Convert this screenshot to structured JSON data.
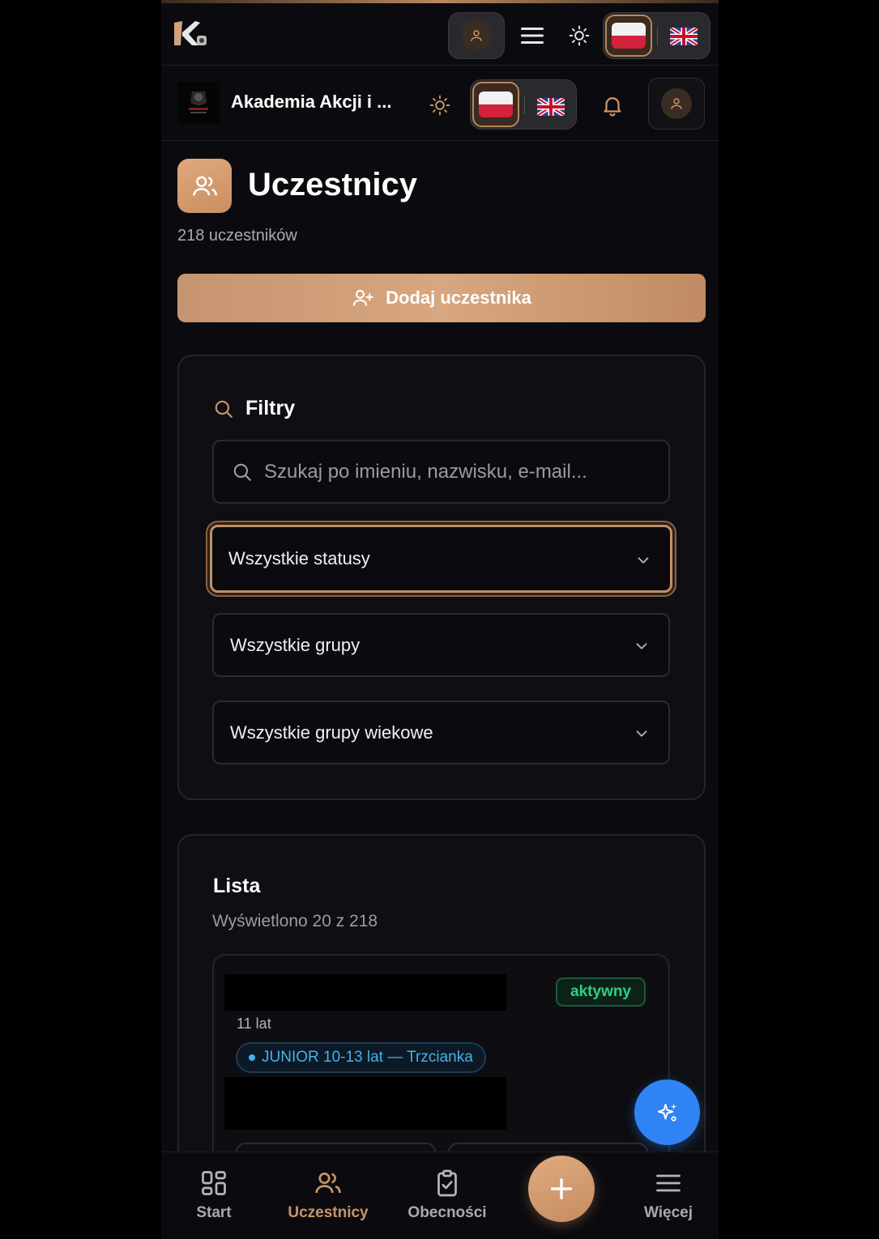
{
  "header": {
    "club_name": "Akademia Akcji i ..."
  },
  "page": {
    "title": "Uczestnicy",
    "subtitle": "218 uczestników",
    "add_button_label": "Dodaj uczestnika"
  },
  "filters": {
    "title": "Filtry",
    "search_placeholder": "Szukaj po imieniu, nazwisku, e-mail...",
    "status_select": "Wszystkie statusy",
    "group_select": "Wszystkie grupy",
    "age_group_select": "Wszystkie grupy wiekowe"
  },
  "list": {
    "title": "Lista",
    "subtitle": "Wyświetlono 20 z 218",
    "items": [
      {
        "status": "aktywny",
        "age": "11 lat",
        "group": "JUNIOR 10-13 lat — Trzcianka"
      }
    ]
  },
  "bottom_nav": {
    "items": [
      {
        "label": "Start",
        "icon": "grid-icon"
      },
      {
        "label": "Uczestnicy",
        "icon": "users-icon",
        "active": true
      },
      {
        "label": "Obecności",
        "icon": "clipboard-check-icon"
      },
      {
        "label": "Więcej",
        "icon": "menu-icon"
      }
    ]
  },
  "colors": {
    "accent": "#c99467",
    "status_active": "#2fcf82",
    "group_badge": "#45b2e6",
    "ai_fab": "#2f83f2"
  }
}
